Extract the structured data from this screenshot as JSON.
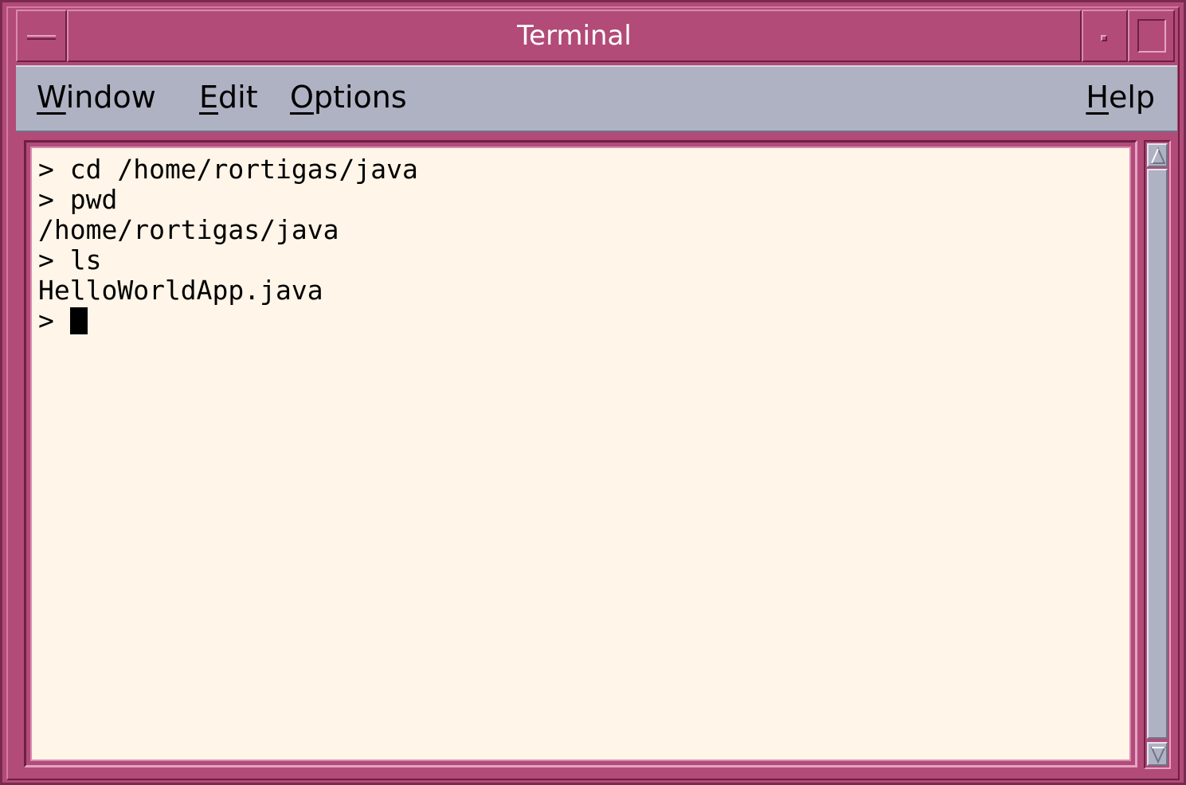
{
  "window": {
    "title": "Terminal"
  },
  "menubar": {
    "items": [
      {
        "label": "Window",
        "mnemonic": "W"
      },
      {
        "label": "Edit",
        "mnemonic": "E"
      },
      {
        "label": "Options",
        "mnemonic": "O"
      }
    ],
    "help": {
      "label": "Help",
      "mnemonic": "H"
    }
  },
  "terminal": {
    "lines": [
      "> cd /home/rortigas/java",
      "> pwd",
      "/home/rortigas/java",
      "> ls",
      "HelloWorldApp.java"
    ],
    "prompt": "> "
  },
  "colors": {
    "frame": "#b24b78",
    "menubar": "#aeb2c3",
    "terminal_bg": "#fff5e8",
    "text": "#000000",
    "title_text": "#ffffff"
  },
  "icons": {
    "window_menu": "window-menu-icon",
    "minimize": "minimize-icon",
    "maximize": "maximize-icon",
    "scroll_up": "scroll-up-arrow-icon",
    "scroll_down": "scroll-down-arrow-icon"
  }
}
